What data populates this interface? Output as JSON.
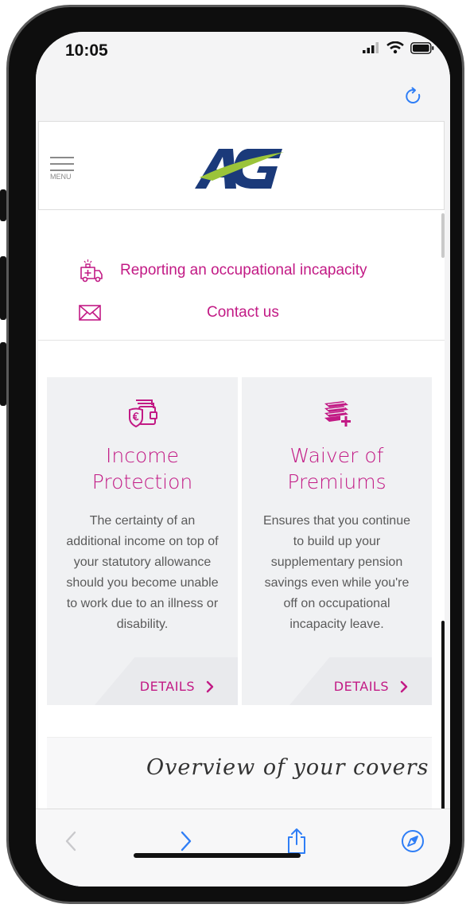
{
  "status_bar": {
    "time": "10:05"
  },
  "header": {
    "menu_label": "MENU",
    "logo_text": "AG"
  },
  "links": [
    {
      "label": "Reporting an occupational incapacity",
      "icon": "ambulance-icon"
    },
    {
      "label": "Contact us",
      "icon": "envelope-icon"
    }
  ],
  "cards": [
    {
      "icon": "euro-shield-wallet-icon",
      "title_line1": "Income",
      "title_line2": "Protection",
      "desc": [
        "The certainty of an",
        "additional income on top of",
        "your statutory allowance",
        "should you become unable",
        "to work due to an illness or",
        "disability."
      ],
      "details_label": "DETAILS"
    },
    {
      "icon": "money-stack-plus-icon",
      "title_line1": "Waiver of",
      "title_line2": "Premiums",
      "desc": [
        "Ensures that you continue",
        "to build up your",
        "supplementary pension",
        "savings even while you're",
        "off on occupational",
        "incapacity leave."
      ],
      "details_label": "DETAILS"
    }
  ],
  "overview": {
    "label": "Overview of your covers"
  },
  "colors": {
    "accent": "#c21a85",
    "logo_blue": "#1b3a7a",
    "logo_green": "#9bc43a",
    "ios_blue": "#2f7ef6"
  }
}
